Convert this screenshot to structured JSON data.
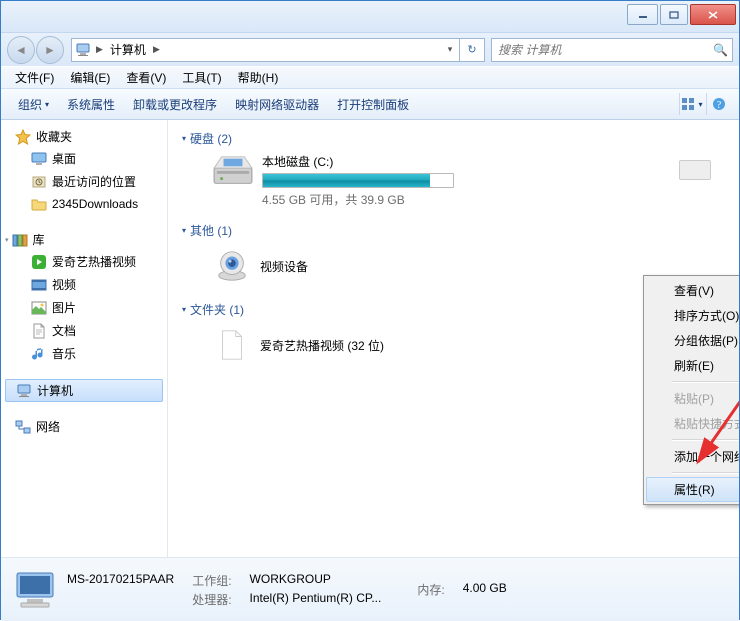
{
  "window": {
    "title": "计算机"
  },
  "address": {
    "root": "计算机"
  },
  "search": {
    "placeholder": "搜索 计算机"
  },
  "menubar": [
    "文件(F)",
    "编辑(E)",
    "查看(V)",
    "工具(T)",
    "帮助(H)"
  ],
  "toolbar": {
    "organize": "组织",
    "items": [
      "系统属性",
      "卸载或更改程序",
      "映射网络驱动器",
      "打开控制面板"
    ]
  },
  "sidebar": {
    "favorites": {
      "label": "收藏夹",
      "items": [
        "桌面",
        "最近访问的位置",
        "2345Downloads"
      ]
    },
    "libraries": {
      "label": "库",
      "items": [
        "爱奇艺热播视频",
        "视频",
        "图片",
        "文档",
        "音乐"
      ]
    },
    "computer": {
      "label": "计算机"
    },
    "network": {
      "label": "网络"
    }
  },
  "groups": {
    "drives": {
      "label": "硬盘 (2)",
      "item": {
        "name": "本地磁盘 (C:)",
        "sub": "4.55 GB 可用，共 39.9 GB"
      }
    },
    "other": {
      "label": "其他 (1)",
      "item": {
        "name": "视频设备"
      }
    },
    "folders": {
      "label": "文件夹 (1)",
      "item": {
        "name": "爱奇艺热播视频 (32 位)"
      }
    }
  },
  "context_menu": {
    "view": "查看(V)",
    "sort": "排序方式(O)",
    "group": "分组依据(P)",
    "refresh": "刷新(E)",
    "paste": "粘贴(P)",
    "paste_shortcut": "粘贴快捷方式(S)",
    "add_location": "添加一个网络位置(L)",
    "properties": "属性(R)"
  },
  "status": {
    "name": "MS-20170215PAAR",
    "workgroup_lbl": "工作组:",
    "workgroup": "WORKGROUP",
    "mem_lbl": "内存:",
    "mem": "4.00 GB",
    "cpu_lbl": "处理器:",
    "cpu": "Intel(R) Pentium(R) CP..."
  }
}
